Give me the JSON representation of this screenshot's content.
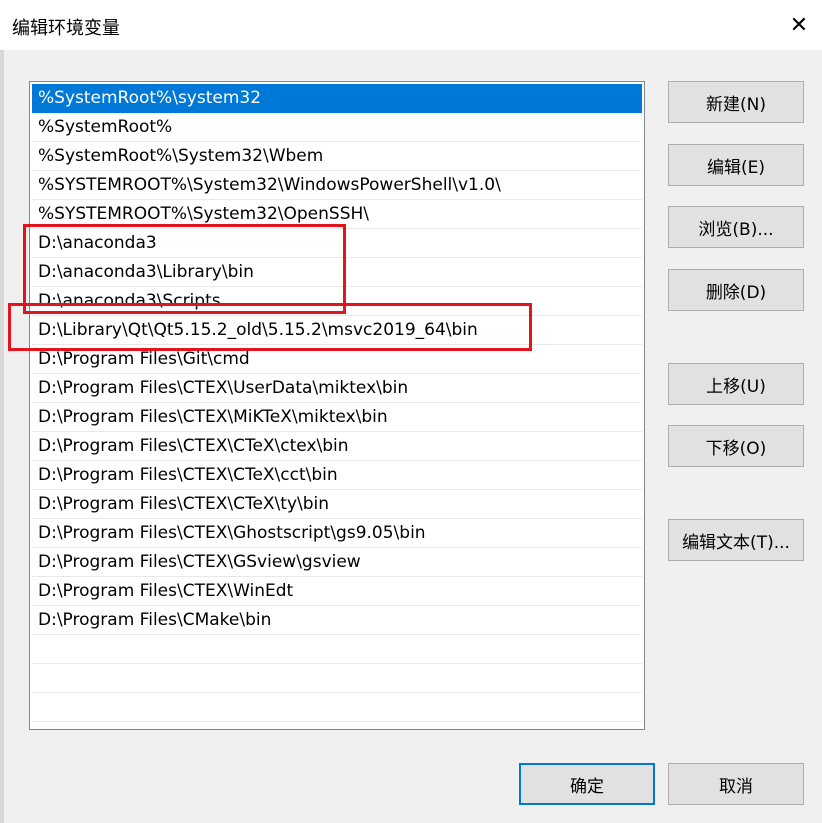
{
  "window": {
    "title": "编辑环境变量",
    "close_glyph": "✕"
  },
  "path_list": {
    "selected_index": 0,
    "entries": [
      "%SystemRoot%\\system32",
      "%SystemRoot%",
      "%SystemRoot%\\System32\\Wbem",
      "%SYSTEMROOT%\\System32\\WindowsPowerShell\\v1.0\\",
      "%SYSTEMROOT%\\System32\\OpenSSH\\",
      "D:\\anaconda3",
      "D:\\anaconda3\\Library\\bin",
      "D:\\anaconda3\\Scripts",
      "D:\\Library\\Qt\\Qt5.15.2_old\\5.15.2\\msvc2019_64\\bin",
      "D:\\Program Files\\Git\\cmd",
      "D:\\Program Files\\CTEX\\UserData\\miktex\\bin",
      "D:\\Program Files\\CTEX\\MiKTeX\\miktex\\bin",
      "D:\\Program Files\\CTEX\\CTeX\\ctex\\bin",
      "D:\\Program Files\\CTEX\\CTeX\\cct\\bin",
      "D:\\Program Files\\CTEX\\CTeX\\ty\\bin",
      "D:\\Program Files\\CTEX\\Ghostscript\\gs9.05\\bin",
      "D:\\Program Files\\CTEX\\GSview\\gsview",
      "D:\\Program Files\\CTEX\\WinEdt",
      "D:\\Program Files\\CMake\\bin",
      "",
      "",
      ""
    ]
  },
  "buttons": {
    "new": "新建(N)",
    "edit": "编辑(E)",
    "browse": "浏览(B)...",
    "delete": "删除(D)",
    "move_up": "上移(U)",
    "move_down": "下移(O)",
    "edit_text": "编辑文本(T)...",
    "ok": "确定",
    "cancel": "取消"
  },
  "colors": {
    "selection": "#0078d7",
    "annotation_box": "#e3141c"
  }
}
